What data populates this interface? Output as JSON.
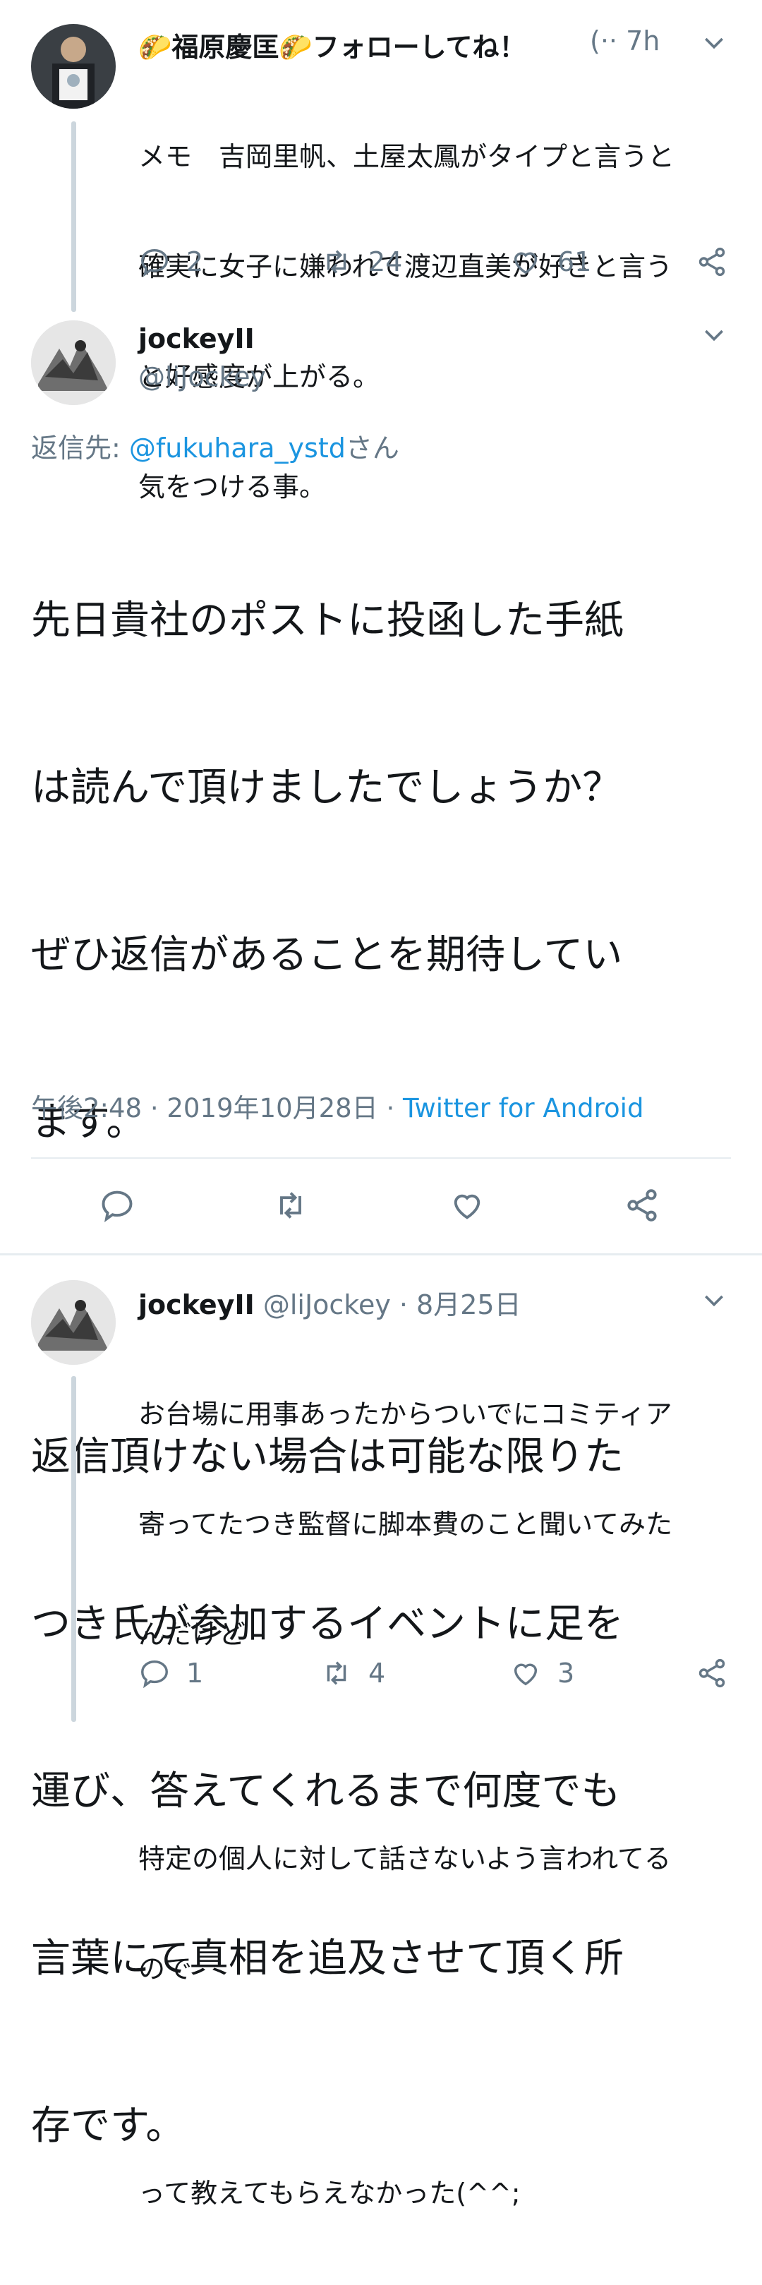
{
  "tweet1": {
    "display_name": "🌮福原慶匡🌮フォローしてね！",
    "handle_time": "(·· 7h",
    "lines": [
      "メモ　吉岡里帆、土屋太鳳がタイプと言うと",
      "確実に女子に嫌われて渡辺直美が好きと言う",
      "と好感度が上がる。",
      "気をつける事。"
    ],
    "stats": {
      "replies": "2",
      "retweets": "24",
      "likes": "61"
    }
  },
  "tweet2": {
    "display_name": "jockeyII",
    "handle": "@liJockey",
    "reply_prefix": "返信先: ",
    "reply_target": "@fukuhara_ystd",
    "reply_suffix": "さん",
    "body_lines": [
      "先日貴社のポストに投函した手紙",
      "は読んで頂けましたでしょうか？",
      "ぜひ返信があることを期待してい",
      "ます。",
      "",
      "返信頂けない場合は可能な限りた",
      "つき氏が参加するイベントに足を",
      "運び、答えてくれるまで何度でも",
      "言葉にて真相を追及させて頂く所",
      "存です。"
    ],
    "timestamp": "午後2:48 · 2019年10月28日 · ",
    "client": "Twitter for Android"
  },
  "tweet3": {
    "display_name": "jockeyII",
    "handle_time": "@liJockey · 8月25日",
    "lines": [
      "お台場に用事あったからついでにコミティア",
      "寄ってたつき監督に脚本費のこと聞いてみた",
      "んだけど",
      "",
      "特定の個人に対して話さないよう言われてる",
      "ので",
      "",
      "って教えてもらえなかった(^^;"
    ],
    "stats": {
      "replies": "1",
      "retweets": "4",
      "likes": "3"
    }
  },
  "icons": [
    "reply-icon",
    "retweet-icon",
    "like-icon",
    "share-icon",
    "chevron-down-icon"
  ],
  "colors": {
    "link": "#1b95e0",
    "muted": "#657786",
    "thread": "#ccd6dd"
  }
}
